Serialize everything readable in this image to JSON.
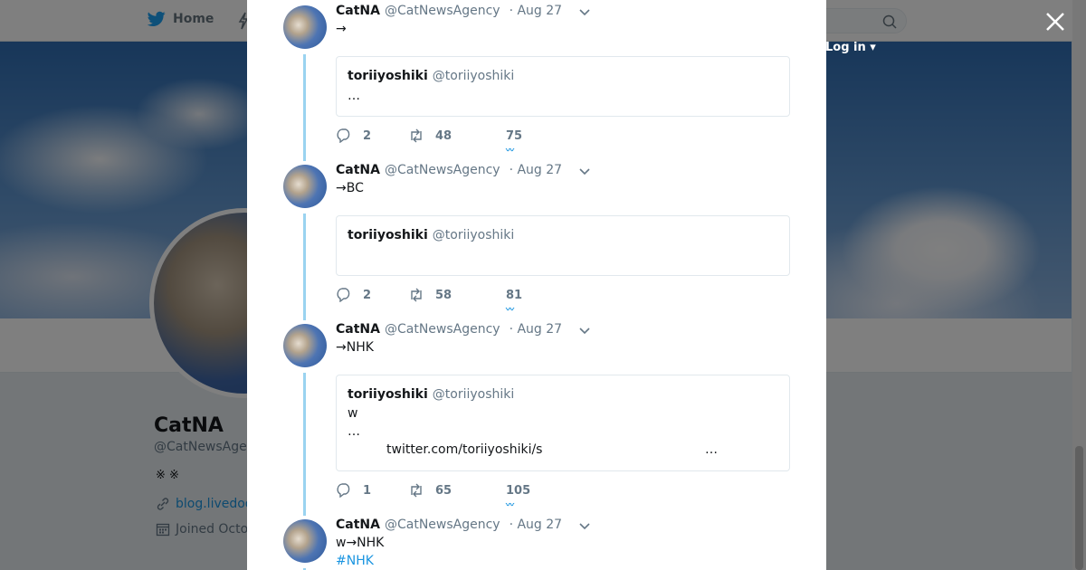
{
  "nav": {
    "home_label": "Home",
    "login_label": "Log in"
  },
  "profile": {
    "name": "CatNA",
    "handle": "@CatNewsAge",
    "bio": "※ ※",
    "link": "blog.livedoo",
    "joined": "Joined Octo"
  },
  "tweets": [
    {
      "name": "CatNA",
      "handle": "@CatNewsAgency",
      "time": "· Aug 27",
      "text": "→",
      "quote": {
        "name": "toriiyoshiki",
        "handle": "@toriiyoshiki",
        "lines": [
          "…"
        ]
      },
      "replies": "2",
      "retweets": "48",
      "likes": "75"
    },
    {
      "name": "CatNA",
      "handle": "@CatNewsAgency",
      "time": "· Aug 27",
      "text": "→BC",
      "quote": {
        "name": "toriiyoshiki",
        "handle": "@toriiyoshiki",
        "lines": []
      },
      "replies": "2",
      "retweets": "58",
      "likes": "81"
    },
    {
      "name": "CatNA",
      "handle": "@CatNewsAgency",
      "time": "· Aug 27",
      "text": "→NHK",
      "quote": {
        "name": "toriiyoshiki",
        "handle": "@toriiyoshiki",
        "lines": [
          "w",
          "…"
        ],
        "url": "twitter.com/toriiyoshiki/s",
        "url_ellipsis": "…"
      },
      "replies": "1",
      "retweets": "65",
      "likes": "105"
    },
    {
      "name": "CatNA",
      "handle": "@CatNewsAgency",
      "time": "· Aug 27",
      "text": "w→NHK",
      "hashtag": "#NHK"
    }
  ],
  "colors": {
    "accent": "#1b95e0",
    "thread": "#9ad3f0",
    "muted": "#657786"
  }
}
